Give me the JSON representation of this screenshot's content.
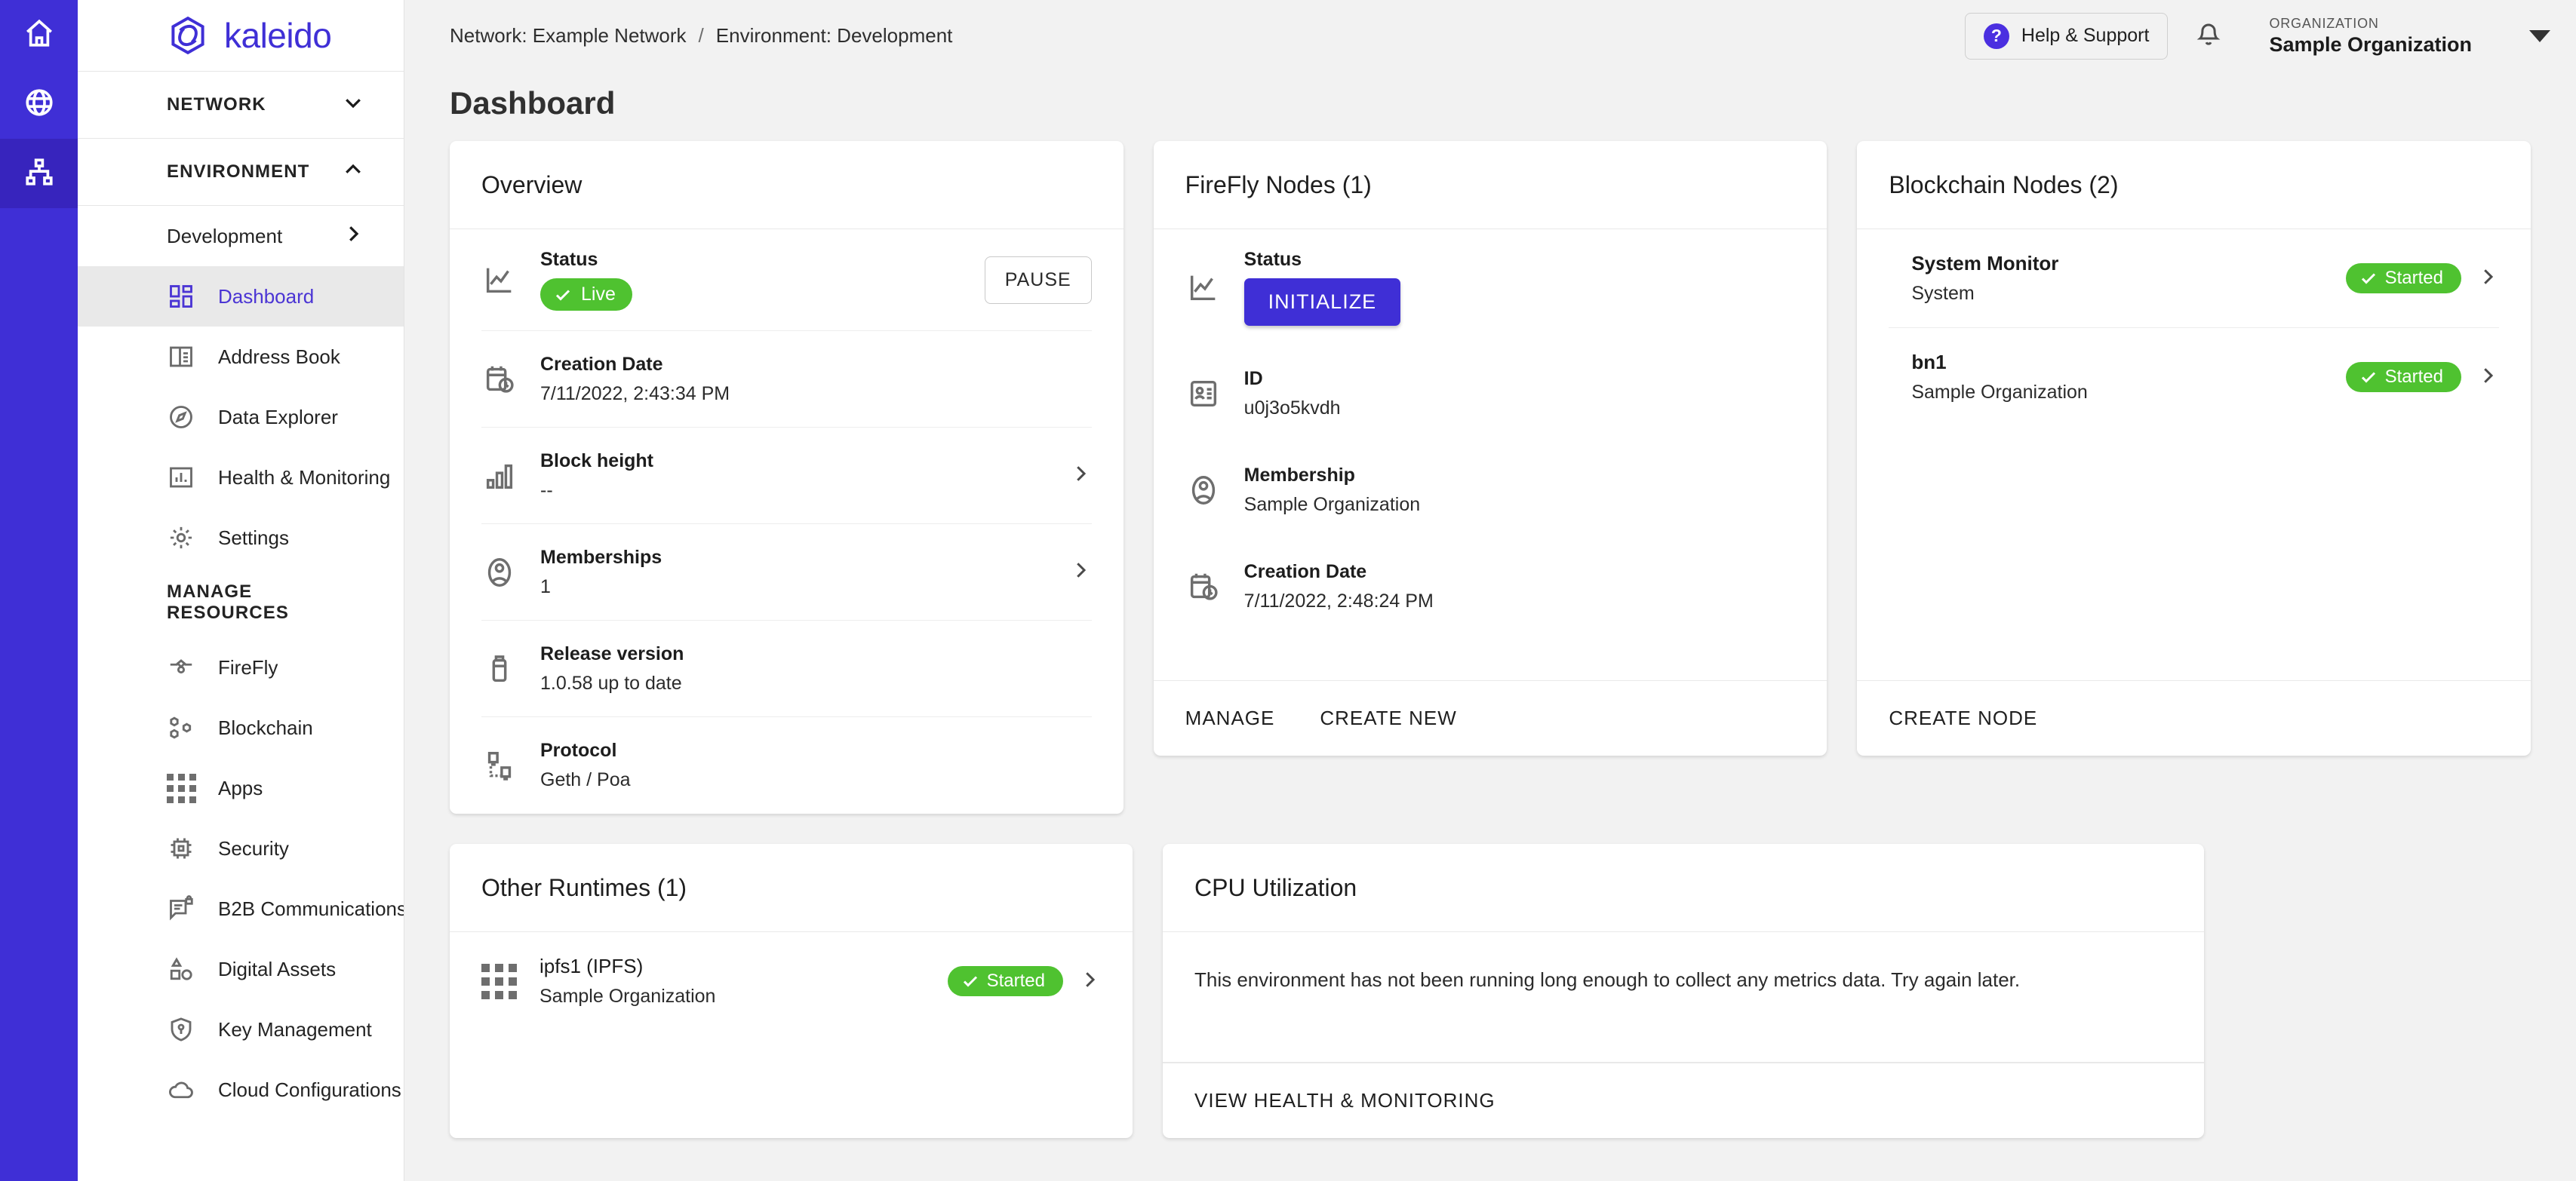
{
  "rail": {
    "items": [
      {
        "name": "home-icon",
        "label": "Home",
        "active": false
      },
      {
        "name": "globe-icon",
        "label": "Networks",
        "active": false
      },
      {
        "name": "sitemap-icon",
        "label": "Environments",
        "active": true
      }
    ]
  },
  "brand": {
    "name": "kaleido",
    "color": "#3f2fd6"
  },
  "sidebar": {
    "sections": [
      {
        "label": "NETWORK",
        "expanded": false,
        "icon": "chevron-down-icon"
      },
      {
        "label": "ENVIRONMENT",
        "expanded": true,
        "icon": "chevron-up-icon"
      }
    ],
    "environment_item": {
      "label": "Development",
      "icon": "chevron-right-icon"
    },
    "items": [
      {
        "label": "Dashboard",
        "icon": "dashboard-icon",
        "active": true
      },
      {
        "label": "Address Book",
        "icon": "address-book-icon",
        "active": false
      },
      {
        "label": "Data Explorer",
        "icon": "compass-icon",
        "active": false
      },
      {
        "label": "Health & Monitoring",
        "icon": "bar-chart-icon",
        "active": false
      },
      {
        "label": "Settings",
        "icon": "gear-icon",
        "active": false
      }
    ],
    "group_label": "MANAGE RESOURCES",
    "resources": [
      {
        "label": "FireFly",
        "icon": "firefly-icon"
      },
      {
        "label": "Blockchain",
        "icon": "blockchain-icon"
      },
      {
        "label": "Apps",
        "icon": "apps-grid-icon"
      },
      {
        "label": "Security",
        "icon": "chip-icon"
      },
      {
        "label": "B2B Communications",
        "icon": "secure-message-icon"
      },
      {
        "label": "Digital Assets",
        "icon": "shapes-icon"
      },
      {
        "label": "Key Management",
        "icon": "shield-key-icon"
      },
      {
        "label": "Cloud Configurations",
        "icon": "cloud-icon"
      }
    ]
  },
  "topbar": {
    "breadcrumb_network": "Network: Example Network",
    "breadcrumb_sep": "/",
    "breadcrumb_environment": "Environment: Development",
    "help_label": "Help & Support",
    "help_glyph": "?",
    "bell_icon": "notification-bell-icon",
    "org_kicker": "ORGANIZATION",
    "org_name": "Sample Organization",
    "caret_icon": "caret-down-icon"
  },
  "page": {
    "title": "Dashboard"
  },
  "overview": {
    "title": "Overview",
    "rows": [
      {
        "icon": "line-chart-icon",
        "label": "Status",
        "badge": "Live",
        "action": "PAUSE"
      },
      {
        "icon": "calendar-clock-icon",
        "label": "Creation Date",
        "value": "7/11/2022, 2:43:34 PM"
      },
      {
        "icon": "bar-chart-icon",
        "label": "Block height",
        "value": "--",
        "chevron": true
      },
      {
        "icon": "membership-icon",
        "label": "Memberships",
        "value": "1",
        "chevron": true
      },
      {
        "icon": "release-icon",
        "label": "Release version",
        "value": "1.0.58 up to date"
      },
      {
        "icon": "protocol-icon",
        "label": "Protocol",
        "value": "Geth / Poa"
      }
    ]
  },
  "firefly": {
    "title": "FireFly Nodes (1)",
    "rows": [
      {
        "icon": "line-chart-icon",
        "label": "Status",
        "button": "INITIALIZE"
      },
      {
        "icon": "id-card-icon",
        "label": "ID",
        "value": "u0j3o5kvdh"
      },
      {
        "icon": "membership-icon",
        "label": "Membership",
        "value": "Sample Organization"
      },
      {
        "icon": "calendar-clock-icon",
        "label": "Creation Date",
        "value": "7/11/2022, 2:48:24 PM"
      }
    ],
    "footer": [
      "MANAGE",
      "CREATE NEW"
    ]
  },
  "blockchain": {
    "title": "Blockchain Nodes (2)",
    "nodes": [
      {
        "icon": "node-target-icon",
        "name": "System Monitor",
        "owner": "System",
        "status": "Started"
      },
      {
        "icon": "node-target-icon",
        "name": "bn1",
        "owner": "Sample Organization",
        "status": "Started"
      }
    ],
    "footer": [
      "CREATE NODE"
    ]
  },
  "other_runtimes": {
    "title": "Other Runtimes (1)",
    "nodes": [
      {
        "icon": "apps-grid-icon",
        "name": "ipfs1 (IPFS)",
        "owner": "Sample Organization",
        "status": "Started"
      }
    ]
  },
  "cpu": {
    "title": "CPU Utilization",
    "message": "This environment has not been running long enough to collect any metrics data. Try again later.",
    "footer": [
      "VIEW HEALTH & MONITORING"
    ]
  },
  "colors": {
    "brand_purple": "#3f2fd6",
    "rail_active": "#3724bd",
    "status_green": "#4fc230",
    "page_bg": "#f2f2f2",
    "card_bg": "#ffffff"
  }
}
